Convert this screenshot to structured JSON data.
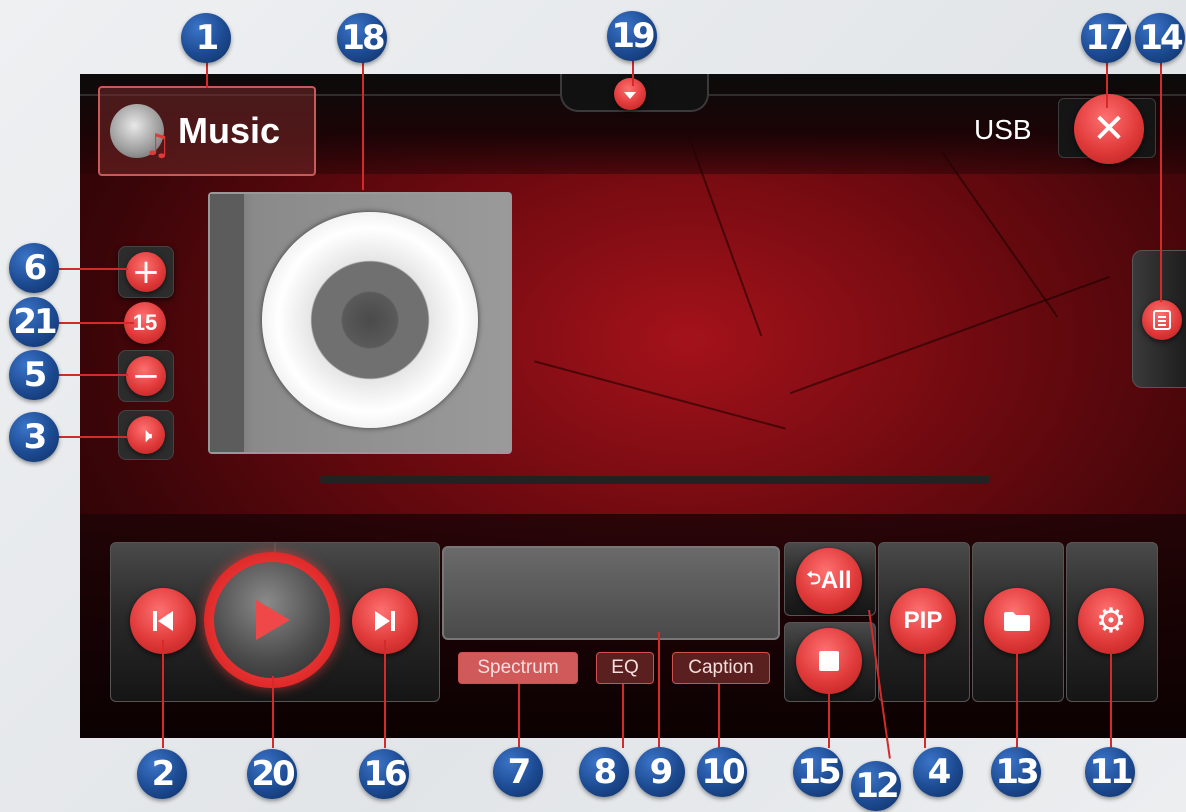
{
  "app": {
    "title": "Music",
    "source": "USB"
  },
  "volume": {
    "level": "15"
  },
  "chips": {
    "spectrum": "Spectrum",
    "eq": "EQ",
    "caption": "Caption"
  },
  "buttons": {
    "repeat_all": "All",
    "pip": "PIP"
  },
  "callouts": [
    "1",
    "18",
    "19",
    "17",
    "14",
    "6",
    "21",
    "5",
    "3",
    "2",
    "20",
    "16",
    "7",
    "8",
    "9",
    "10",
    "15",
    "12",
    "4",
    "13",
    "11"
  ],
  "progress": {
    "fraction": 0
  },
  "colors": {
    "accent": "#e03a3a",
    "callout": "#1c4a91",
    "background": "#6e0a10"
  },
  "icons": {
    "app": "skull-music-icon",
    "close": "close-icon",
    "list": "list-icon",
    "dropdown": "chevron-down-icon",
    "volume_up": "plus-icon",
    "volume_down": "minus-icon",
    "mute": "speaker-icon",
    "previous": "skip-previous-icon",
    "play": "play-icon",
    "next": "skip-next-icon",
    "stop": "stop-icon",
    "folder": "folder-icon",
    "settings": "gear-icon",
    "album_art": "cd-icon"
  }
}
